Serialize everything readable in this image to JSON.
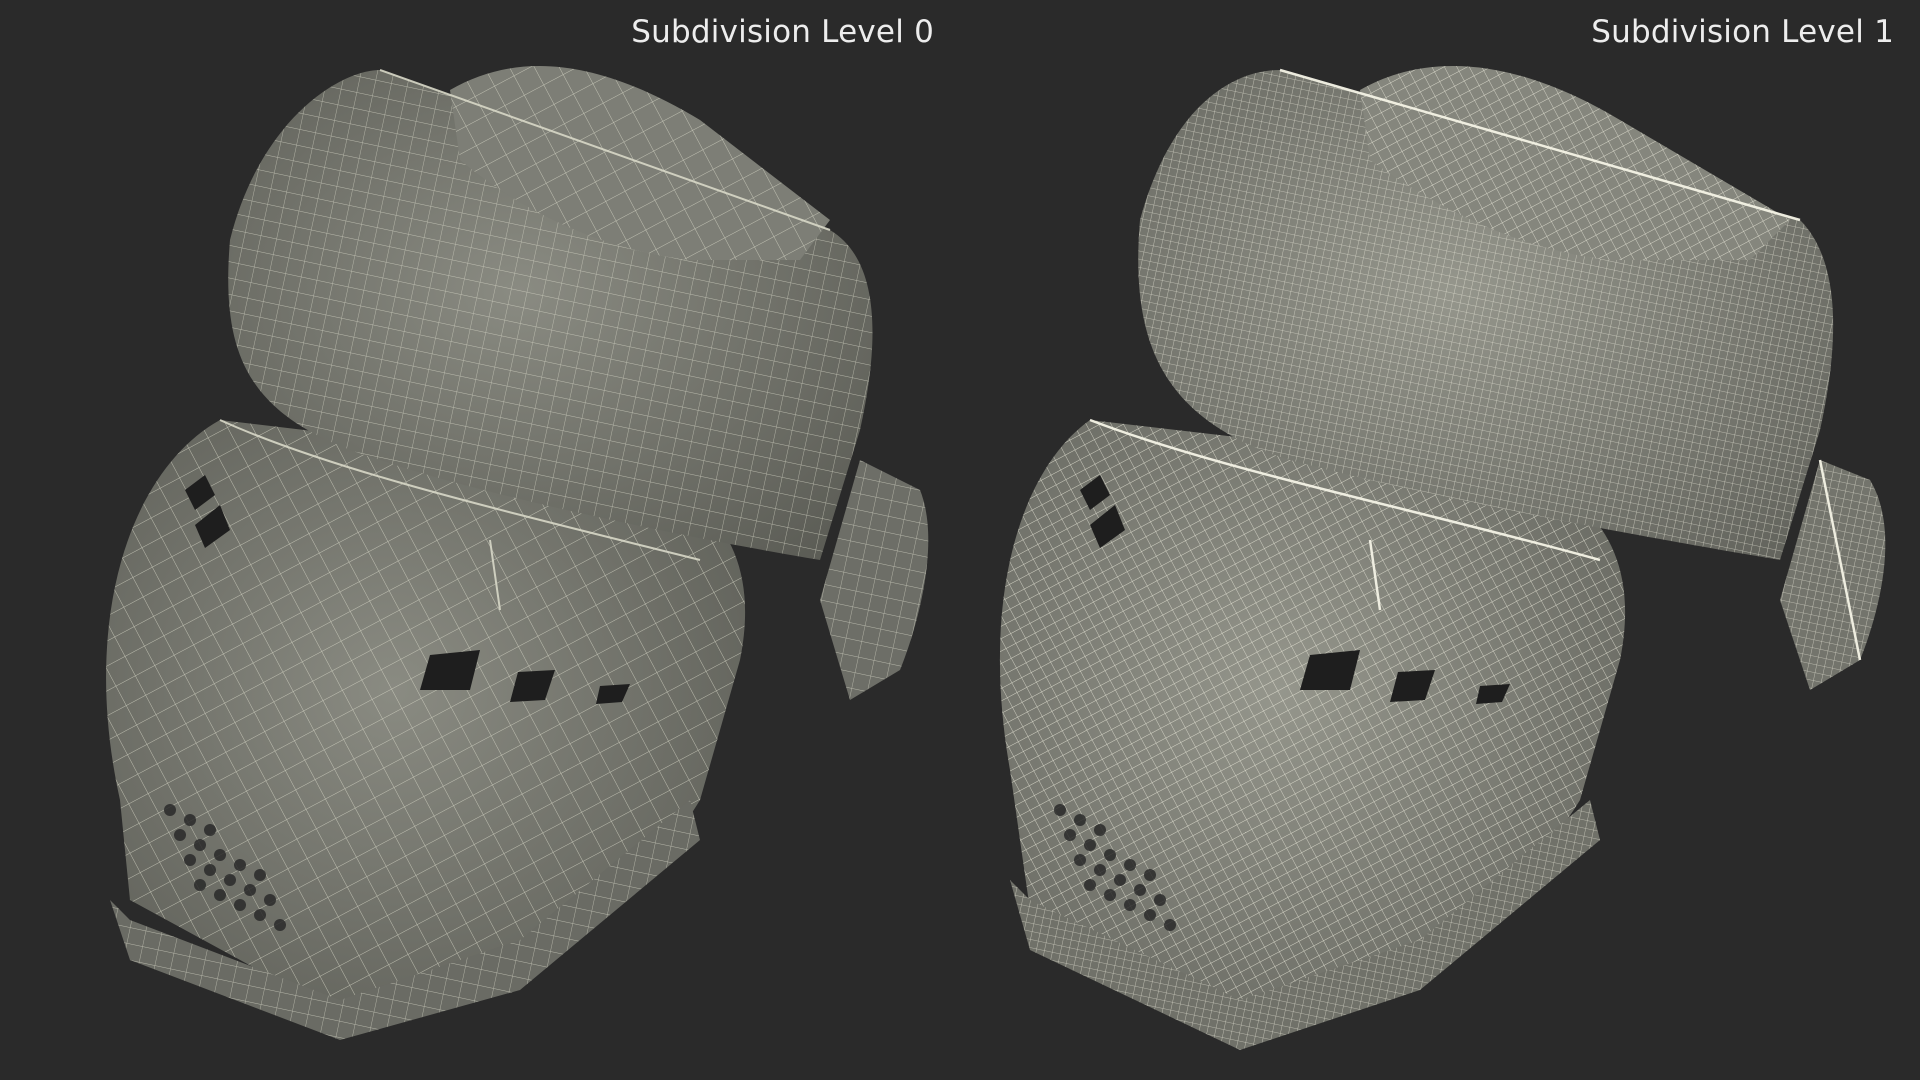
{
  "panels": [
    {
      "label": "Subdivision Level 0",
      "subdivision_level": 0
    },
    {
      "label": "Subdivision Level 1",
      "subdivision_level": 1
    }
  ],
  "colors": {
    "background": "#2a2a2a",
    "mesh_fill": "#7a7b72",
    "mesh_shadow": "#5a5b54",
    "wire_level0": "#d8d8c8",
    "wire_level1": "#ecebdc",
    "label_text": "#ededed"
  }
}
